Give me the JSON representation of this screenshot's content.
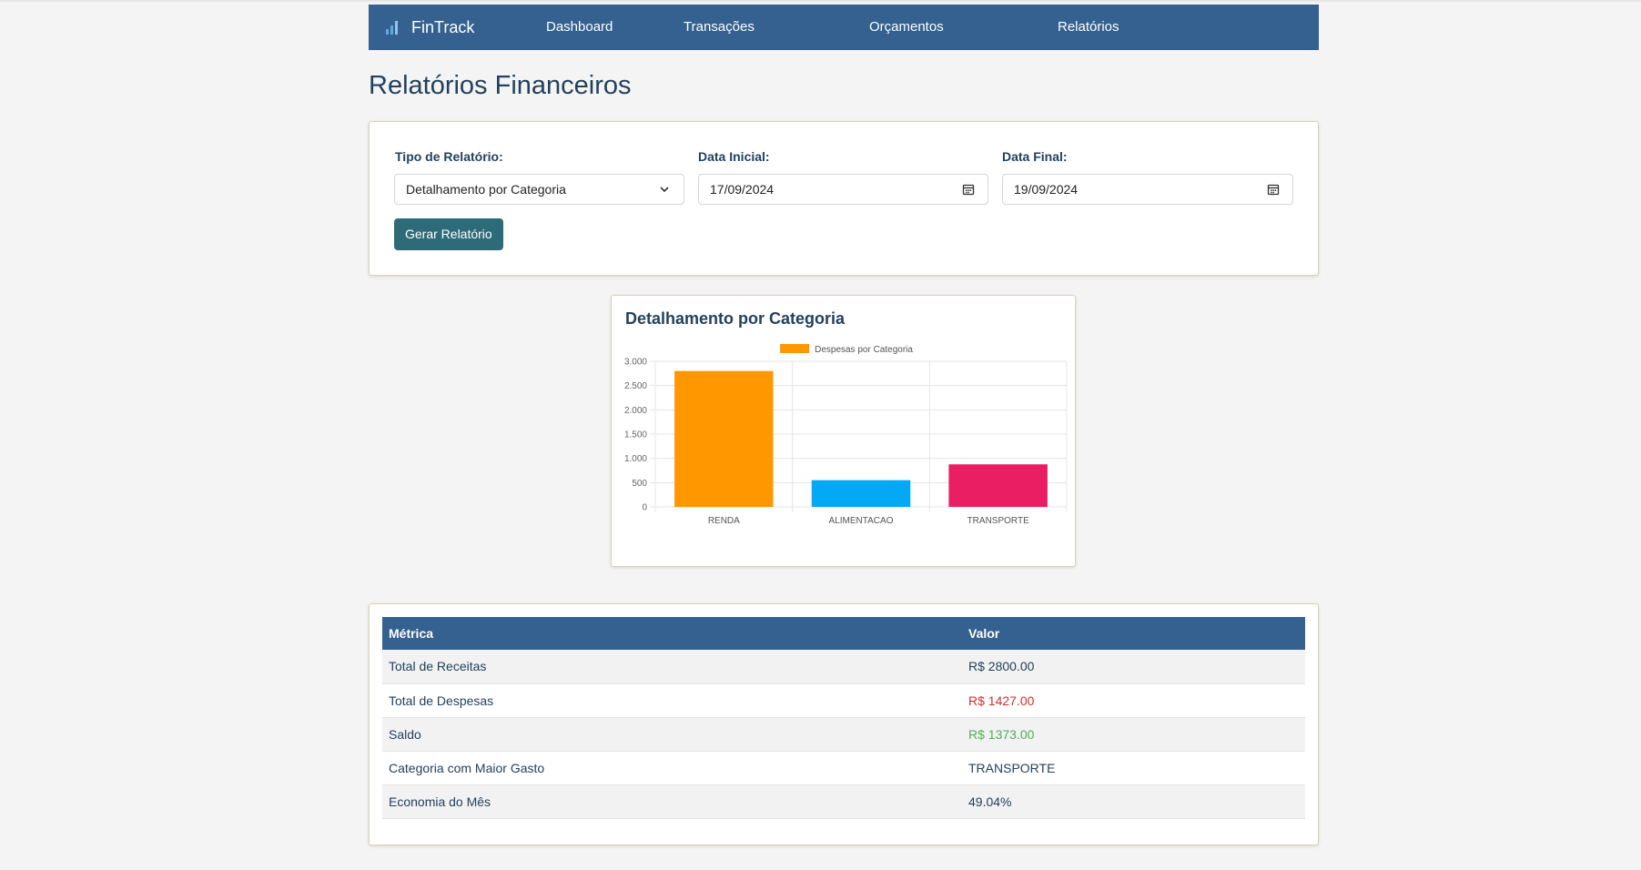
{
  "app": {
    "name": "FinTrack"
  },
  "nav": {
    "items": [
      {
        "label": "Dashboard"
      },
      {
        "label": "Transações"
      },
      {
        "label": "Orçamentos"
      },
      {
        "label": "Relatórios"
      }
    ]
  },
  "page": {
    "title": "Relatórios Financeiros"
  },
  "filters": {
    "report_type_label": "Tipo de Relatório:",
    "report_type_value": "Detalhamento por Categoria",
    "start_date_label": "Data Inicial:",
    "start_date_value": "17/09/2024",
    "end_date_label": "Data Final:",
    "end_date_value": "19/09/2024",
    "generate_label": "Gerar Relatório"
  },
  "chart_data": {
    "type": "bar",
    "title": "Detalhamento por Categoria",
    "categories": [
      "RENDA",
      "ALIMENTACAO",
      "TRANSPORTE"
    ],
    "series": [
      {
        "name": "Despesas por Categoria",
        "values": [
          2800,
          550,
          877
        ],
        "colors": [
          "#ff9800",
          "#03a9f4",
          "#e91e63"
        ]
      }
    ],
    "ylim": [
      0,
      3000
    ],
    "yticks": [
      0,
      500,
      1000,
      1500,
      2000,
      2500,
      3000
    ],
    "ytick_labels": [
      "0",
      "500",
      "1.000",
      "1.500",
      "2.000",
      "2.500",
      "3.000"
    ],
    "legend_position": "top",
    "grid": true,
    "legend_color": "#ff9800"
  },
  "table": {
    "headers": [
      "Métrica",
      "Valor"
    ],
    "rows": [
      {
        "metric": "Total de Receitas",
        "value": "R$ 2800.00",
        "color": "#23415e"
      },
      {
        "metric": "Total de Despesas",
        "value": "R$ 1427.00",
        "color": "#d32f2f"
      },
      {
        "metric": "Saldo",
        "value": "R$ 1373.00",
        "color": "#4caf50"
      },
      {
        "metric": "Categoria com Maior Gasto",
        "value": "TRANSPORTE",
        "color": "#23415e"
      },
      {
        "metric": "Economia do Mês",
        "value": "49.04%",
        "color": "#23415e"
      }
    ]
  },
  "colors": {
    "nav_bg": "#34618f",
    "button_bg": "#2e6b79",
    "text": "#23415e"
  }
}
